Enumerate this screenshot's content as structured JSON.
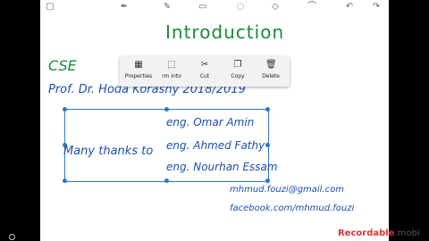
{
  "slide": {
    "title": "Introduction",
    "course": "CSE",
    "professor": "Prof. Dr. Hoda Korashy 2018/2019",
    "thanks": "Many thanks to",
    "engineers": [
      "eng. Omar Amin",
      "eng. Ahmed Fathy",
      "eng. Nourhan Essam"
    ],
    "email": "mhmud.fouzi@gmail.com",
    "facebook": "facebook.com/mhmud.fouzi"
  },
  "context_menu": {
    "items": [
      {
        "label": "Properties",
        "icon": "properties-icon"
      },
      {
        "label": "rm into",
        "icon": "transform-icon"
      },
      {
        "label": "Cut",
        "icon": "scissors-icon"
      },
      {
        "label": "Copy",
        "icon": "copy-icon"
      },
      {
        "label": "Delete",
        "icon": "trash-icon"
      }
    ]
  },
  "toolbar": {
    "icons": [
      "square-icon",
      "pen-icon",
      "pencil-icon",
      "eraser-icon",
      "lasso-icon",
      "shapes-icon",
      "brush-icon",
      "undo-icon",
      "redo-icon"
    ]
  },
  "watermark": {
    "brand": "Recordable",
    "suffix": ".mobi"
  }
}
